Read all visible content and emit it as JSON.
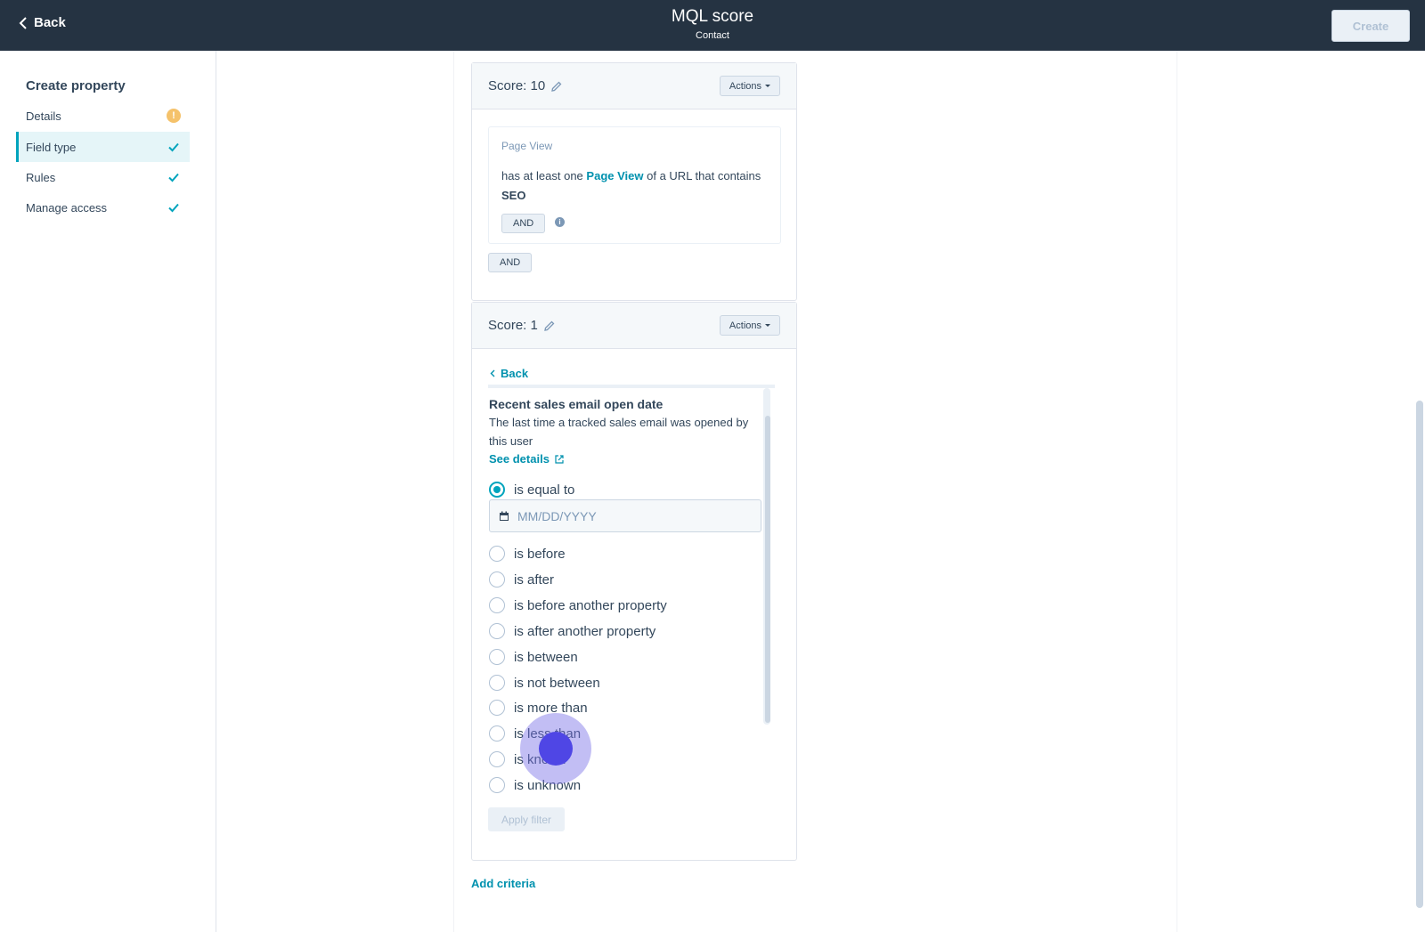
{
  "header": {
    "back_label": "Back",
    "title": "MQL score",
    "subtitle": "Contact",
    "create_label": "Create"
  },
  "sidebar": {
    "title": "Create property",
    "items": [
      {
        "label": "Details",
        "status": "warning"
      },
      {
        "label": "Field type",
        "status": "complete",
        "active": true
      },
      {
        "label": "Rules",
        "status": "complete"
      },
      {
        "label": "Manage access",
        "status": "complete"
      }
    ]
  },
  "score_groups": [
    {
      "score_label": "Score: 10",
      "actions_label": "Actions",
      "filter": {
        "title": "Page View",
        "text_prefix": "has at least one",
        "text_link": "Page View",
        "text_middle": "of a URL that contains",
        "text_bold": "SEO"
      },
      "inner_and_label": "AND",
      "outer_and_label": "AND"
    },
    {
      "score_label": "Score: 1",
      "actions_label": "Actions",
      "back_label": "Back",
      "property": {
        "title": "Recent sales email open date",
        "description": "The last time a tracked sales email was opened by this user",
        "see_details": "See details"
      },
      "date_placeholder": "MM/DD/YYYY",
      "options": [
        {
          "label": "is equal to",
          "checked": true
        },
        {
          "label": "is before",
          "checked": false
        },
        {
          "label": "is after",
          "checked": false
        },
        {
          "label": "is before another property",
          "checked": false
        },
        {
          "label": "is after another property",
          "checked": false
        },
        {
          "label": "is between",
          "checked": false
        },
        {
          "label": "is not between",
          "checked": false
        },
        {
          "label": "is more than",
          "checked": false
        },
        {
          "label": "is less than",
          "checked": false
        },
        {
          "label": "is known",
          "checked": false
        },
        {
          "label": "is unknown",
          "checked": false
        }
      ],
      "apply_label": "Apply filter"
    }
  ],
  "add_criteria_label": "Add criteria",
  "colors": {
    "topbar": "#253342",
    "accent": "#00a4bd",
    "link": "#0091ae",
    "warning": "#f5c26b"
  }
}
